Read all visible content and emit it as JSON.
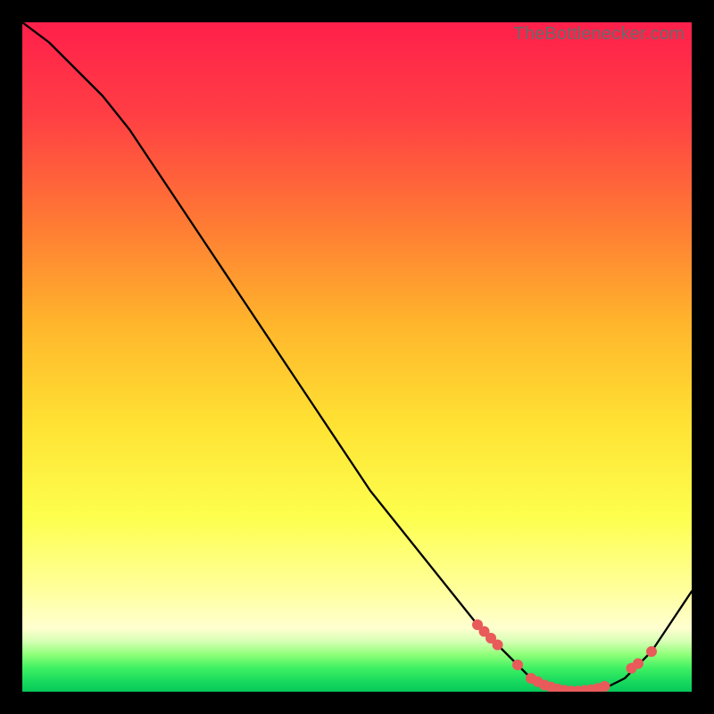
{
  "attribution": "TheBottlenecker.com",
  "colors": {
    "top": "#ff1f4b",
    "mid_upper": "#ff8a2a",
    "mid": "#ffe233",
    "mid_lower": "#f6ff5a",
    "low_yellow": "#ffffa8",
    "green1": "#7dff5e",
    "green2": "#22e96a",
    "bottom": "#06c95a",
    "curve": "#000000",
    "dot": "#e95a5a"
  },
  "chart_data": {
    "type": "line",
    "title": "",
    "xlabel": "",
    "ylabel": "",
    "xlim": [
      0,
      100
    ],
    "ylim": [
      0,
      100
    ],
    "grid": false,
    "legend": false,
    "series": [
      {
        "name": "bottleneck-curve",
        "x": [
          0,
          4,
          8,
          12,
          16,
          20,
          24,
          28,
          32,
          36,
          40,
          44,
          48,
          52,
          56,
          60,
          64,
          68,
          70,
          72,
          74,
          76,
          78,
          80,
          82,
          84,
          86,
          88,
          90,
          92,
          94,
          96,
          98,
          100
        ],
        "y": [
          100,
          97,
          93,
          89,
          84,
          78,
          72,
          66,
          60,
          54,
          48,
          42,
          36,
          30,
          25,
          20,
          15,
          10,
          8,
          6,
          4,
          2,
          1,
          0,
          0,
          0,
          0,
          1,
          2,
          4,
          6,
          9,
          12,
          15
        ]
      }
    ],
    "scatter": {
      "name": "highlight-dots",
      "x": [
        68,
        69,
        70,
        71,
        74,
        76,
        77,
        78,
        79,
        80,
        81,
        82,
        83,
        84,
        85,
        86,
        87,
        91,
        92,
        94
      ],
      "y": [
        10,
        9,
        8,
        7,
        4,
        2,
        1.5,
        1,
        0.7,
        0.4,
        0.2,
        0.1,
        0.1,
        0.2,
        0.3,
        0.5,
        0.8,
        3.5,
        4.2,
        6
      ]
    }
  }
}
